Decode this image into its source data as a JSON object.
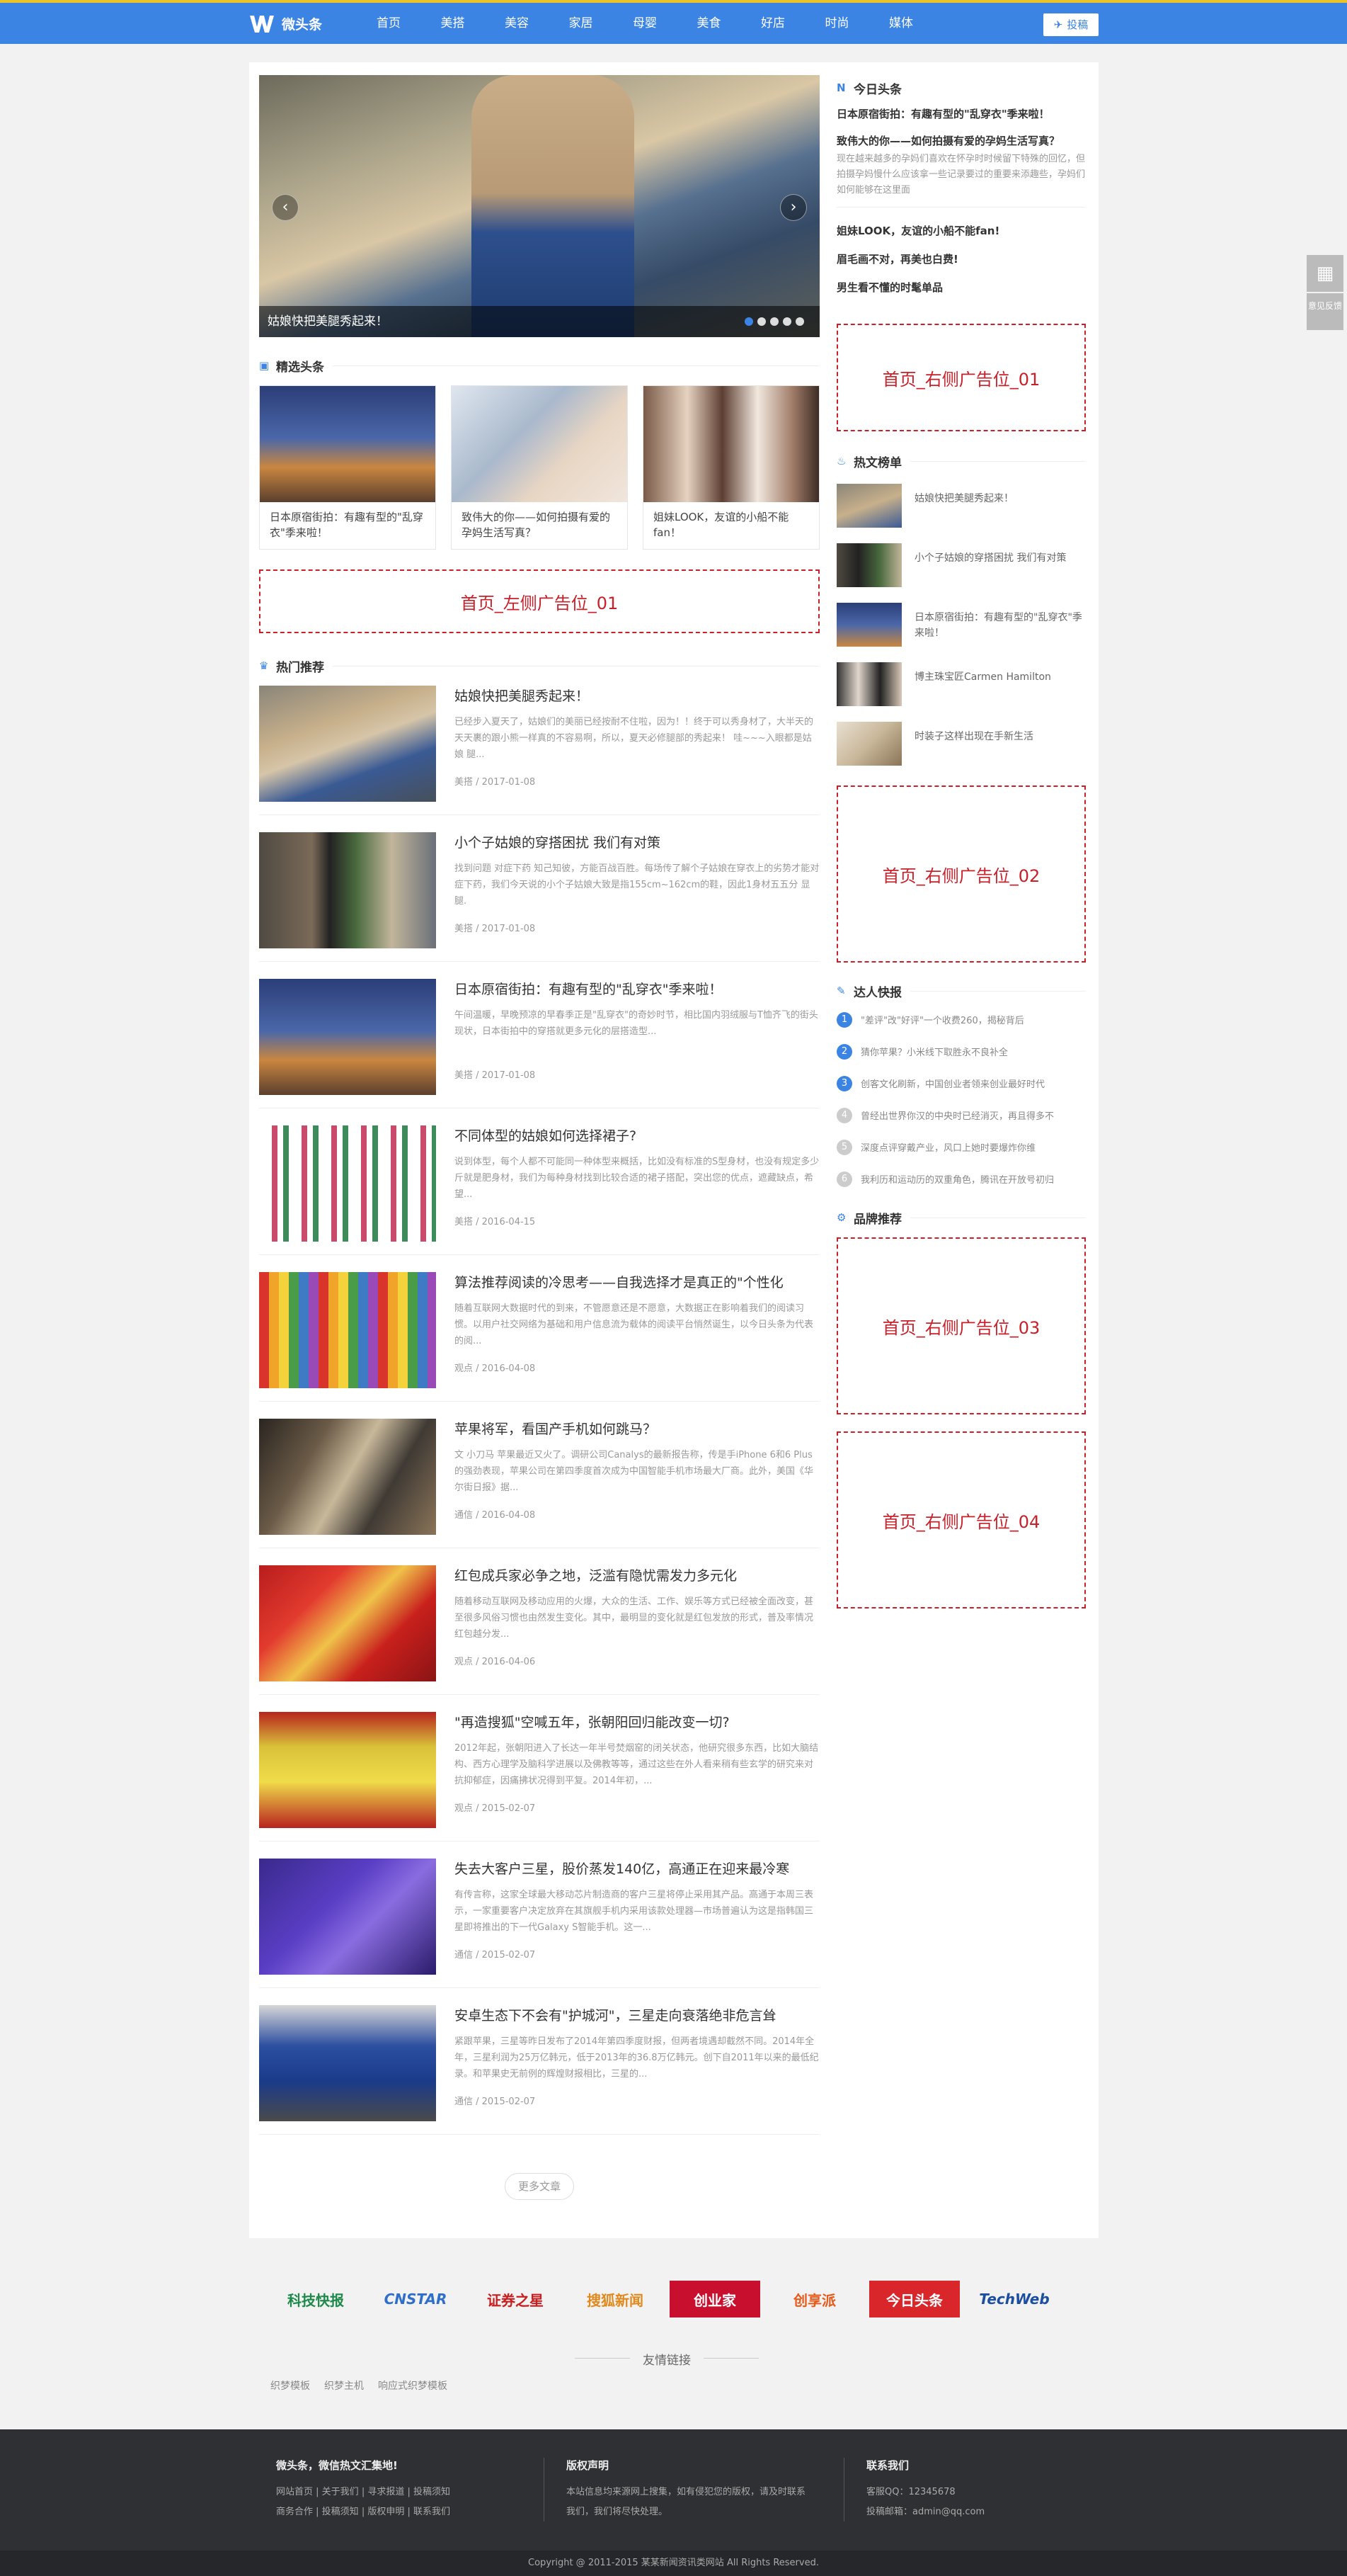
{
  "header": {
    "logo_text": "微头条",
    "nav": [
      "首页",
      "美搭",
      "美容",
      "家居",
      "母婴",
      "美食",
      "好店",
      "时尚",
      "媒体"
    ],
    "post_label": "投稿"
  },
  "slider": {
    "caption": "姑娘快把美腿秀起来！",
    "dots": 5,
    "active_dot": 1
  },
  "featured": {
    "title": "精选头条",
    "items": [
      "日本原宿街拍：有趣有型的\"乱穿衣\"季来啦！",
      "致伟大的你——如何拍摄有爱的孕妈生活写真？",
      "姐妹LOOK，友谊的小船不能fan！"
    ]
  },
  "ad_left": "首页_左侧广告位_01",
  "hot_recommend": {
    "title": "热门推荐",
    "articles": [
      {
        "title": "姑娘快把美腿秀起来！",
        "desc": "已经步入夏天了，姑娘们的美丽已经按耐不住啦，因为！！终于可以秀身材了，大半天的天天裹的跟小熊一样真的不容易啊，所以，夏天必修腿部的秀起来！ 哇~~~入眼都是姑娘 腿...",
        "meta": "美搭 / 2017-01-08"
      },
      {
        "title": "小个子姑娘的穿搭困扰 我们有对策",
        "desc": "找到问题 对症下药 知己知彼，方能百战百胜。每场传了解个子姑娘在穿衣上的劣势才能对症下药，我们今天说的小个子姑娘大致是指155cm~162cm的鞋，因此1身材五五分 显腿.",
        "meta": "美搭 / 2017-01-08"
      },
      {
        "title": "日本原宿街拍：有趣有型的\"乱穿衣\"季来啦！",
        "desc": "午间温暖，早晚预凉的早春季正是\"乱穿衣\"的奇妙时节，相比国内羽绒服与T恤齐飞的街头现状，日本街拍中的穿搭就更多元化的层搭造型...",
        "meta": "美搭 / 2017-01-08"
      },
      {
        "title": "不同体型的姑娘如何选择裙子?",
        "desc": "说到体型，每个人都不可能同一种体型来概括，比如没有标准的S型身材，也没有规定多少斤就是肥身材，我们为每种身材找到比较合适的裙子搭配，突出您的优点，遮藏缺点，希望...",
        "meta": "美搭 / 2016-04-15"
      },
      {
        "title": "算法推荐阅读的冷思考——自我选择才是真正的\"个性化",
        "desc": "随着互联网大数据时代的到来，不管愿意还是不愿意，大数据正在影响着我们的阅读习惯。以用户社交网络为基础和用户信息流为载体的阅读平台悄然诞生，以今日头条为代表的阅...",
        "meta": "观点 / 2016-04-08"
      },
      {
        "title": "苹果将军，看国产手机如何跳马？",
        "desc": "文 小刀马 苹果最近又火了。调研公司Canalys的最新报告称，传是手iPhone 6和6 Plus的强劲表现，苹果公司在第四季度首次成为中国智能手机市场最大厂商。此外，美国《华尔街日报》据...",
        "meta": "通信 / 2016-04-08"
      },
      {
        "title": "红包成兵家必争之地，泛滥有隐忧需发力多元化",
        "desc": "随着移动互联网及移动应用的火爆，大众的生活、工作、娱乐等方式已经被全面改变，甚至很多风俗习惯也由然发生变化。其中，最明显的变化就是红包发放的形式，普及率情况红包越分发...",
        "meta": "观点 / 2016-04-06"
      },
      {
        "title": "\"再造搜狐\"空喊五年，张朝阳回归能改变一切?",
        "desc": "2012年起，张朝阳进入了长达一年半号焚烟窑的闭关状态，他研究很多东西，比如大脑结构、西方心理学及脑科学进展以及佛教等等，通过这些在外人看来稍有些玄学的研究来对抗抑郁症，因痛拂状况得到平复。2014年初，...",
        "meta": "观点 / 2015-02-07"
      },
      {
        "title": "失去大客户三星，股价蒸发140亿，高通正在迎来最冷寒",
        "desc": "有传言称，这家全球最大移动芯片制造商的客户三星将停止采用其产品。高通于本周三表示，一家重要客户决定放弃在其旗舰手机内采用该款处理器—市场普遍认为这是指韩国三星即将推出的下一代Galaxy S智能手机。这一...",
        "meta": "通信 / 2015-02-07"
      },
      {
        "title": "安卓生态下不会有\"护城河\"，三星走向衰落绝非危言耸",
        "desc": "紧跟苹果，三星等昨日发布了2014年第四季度财报，但两者境遇却截然不同。2014年全年，三星利润为25万亿韩元，低于2013年的36.8万亿韩元。创下自2011年以来的最低纪录。和苹果史无前例的辉煌财报相比，三星的...",
        "meta": "通信 / 2015-02-07"
      }
    ],
    "more_label": "更多文章"
  },
  "sidebar": {
    "today": {
      "title": "今日头条",
      "headline1": "日本原宿街拍：有趣有型的\"乱穿衣\"季来啦！",
      "headline2": "致伟大的你——如何拍摄有爱的孕妈生活写真？",
      "para": "现在越来越多的孕妈们喜欢在怀孕时时候留下特殊的回忆，但拍摄孕妈慢什么应该拿一些记录要过的重要来添趣些，孕妈们如何能够在这里面",
      "items": [
        "姐妹LOOK，友谊的小船不能fan!",
        "眉毛画不对，再美也白费!",
        "男生看不懂的时髦单品"
      ]
    },
    "ads": [
      "首页_右侧广告位_01",
      "首页_右侧广告位_02",
      "首页_右侧广告位_03",
      "首页_右侧广告位_04"
    ],
    "hot": {
      "title": "热文榜单",
      "items": [
        "姑娘快把美腿秀起来！",
        "小个子姑娘的穿搭困扰 我们有对策",
        "日本原宿街拍：有趣有型的\"乱穿衣\"季来啦！",
        "博主珠宝匠Carmen Hamilton",
        "时装子这样出现在手新生活"
      ]
    },
    "fast": {
      "title": "达人快报",
      "items": [
        "\"差评\"改\"好评\"一个收费260，揭秘背后",
        "猜你苹果？小米线下取胜永不良补全",
        "创客文化刷新，中国创业者领来创业最好时代",
        "曾经出世界你汉的中央时已经消灭，再且得多不",
        "深度点评穿戴产业，风口上她时要爆炸你维",
        "我利历和运动历的双重角色，腾讯在开放号初归"
      ]
    },
    "brand": {
      "title": "品牌推荐"
    }
  },
  "partners": {
    "logos": [
      "科技快报",
      "CNSTAR",
      "证券之星",
      "搜狐新闻",
      "创业家",
      "创享派",
      "今日头条",
      "TechWeb"
    ],
    "friend_title": "友情链接",
    "links": [
      "织梦模板",
      "织梦主机",
      "响应式织梦模板"
    ]
  },
  "footer": {
    "col1": {
      "title": "微头条，微信热文汇集地!",
      "links1": [
        "网站首页",
        "关于我们",
        "寻求报道",
        "投稿须知"
      ],
      "links2": [
        "商务合作",
        "投稿须知",
        "版权申明",
        "联系我们"
      ]
    },
    "col2": {
      "title": "版权声明",
      "text": "本站信息均来源网上搜集，如有侵犯您的版权，请及时联系我们，我们将尽快处理。"
    },
    "col3": {
      "title": "联系我们",
      "qq": "客服QQ：12345678",
      "email": "投稿邮箱：admin@qq.com"
    },
    "copyright": "Copyright @ 2011-2015 某某新闻资讯类网站 All Rights Reserved."
  },
  "float": {
    "qr_label": "二维码",
    "feedback": "意见反馈"
  }
}
